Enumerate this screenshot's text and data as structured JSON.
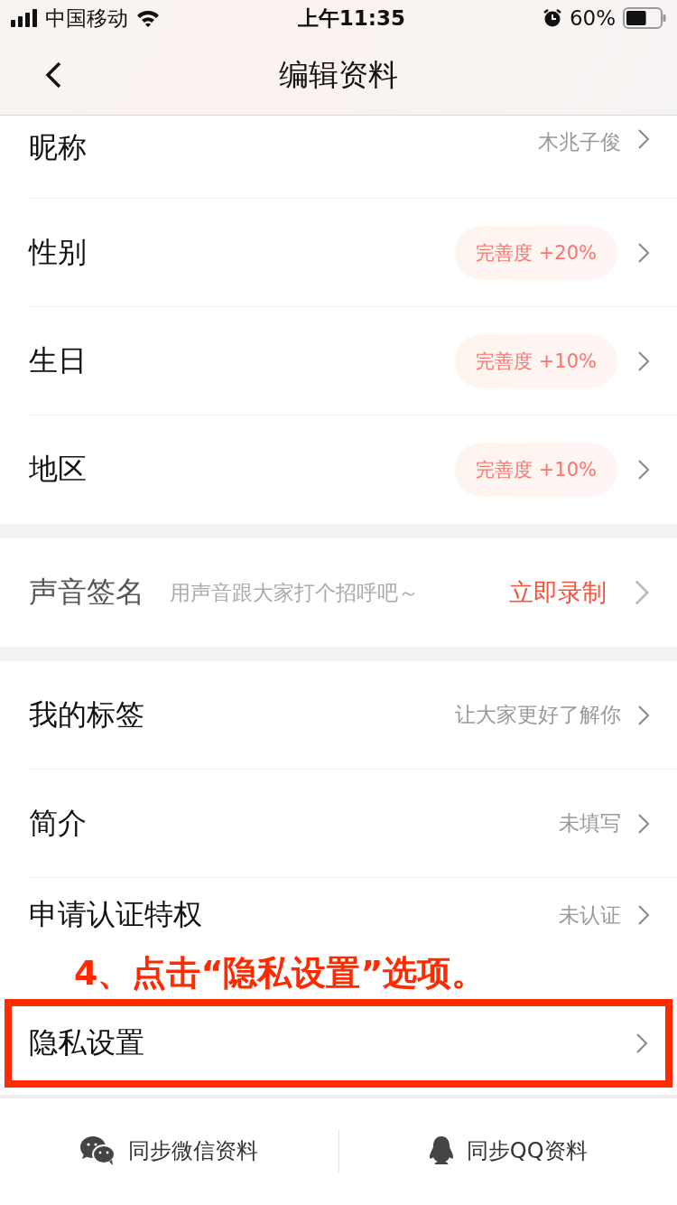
{
  "status_bar": {
    "carrier": "中国移动",
    "time": "上午11:35",
    "battery": "60%"
  },
  "nav": {
    "title": "编辑资料"
  },
  "sections": [
    {
      "rows": [
        {
          "label": "昵称",
          "kind": "value",
          "value": "木兆子俊",
          "cut": true,
          "highlighted": false
        },
        {
          "label": "性别",
          "kind": "badge",
          "value": "完善度 +20%",
          "highlighted": false
        },
        {
          "label": "生日",
          "kind": "badge",
          "value": "完善度 +10%",
          "highlighted": false
        },
        {
          "label": "地区",
          "kind": "badge",
          "value": "完善度 +10%",
          "highlighted": false
        }
      ]
    },
    {
      "rows": [
        {
          "label": "声音签名",
          "kind": "action",
          "hint": "用声音跟大家打个招呼吧～",
          "value": "立即录制",
          "highlighted": false
        }
      ]
    },
    {
      "rows": [
        {
          "label": "我的标签",
          "kind": "value",
          "value": "让大家更好了解你",
          "highlighted": false
        },
        {
          "label": "简介",
          "kind": "value",
          "value": "未填写",
          "highlighted": false
        },
        {
          "label": "申请认证特权",
          "kind": "value",
          "value": "未认证",
          "highlighted": false
        },
        {
          "label": "隐私设置",
          "kind": "plain",
          "highlighted": true,
          "annotation": "4、点击“隐私设置”选项。"
        }
      ]
    }
  ],
  "sync_buttons": [
    {
      "kind": "wechat",
      "label": "同步微信资料"
    },
    {
      "kind": "qq",
      "label": "同步QQ资料"
    }
  ]
}
